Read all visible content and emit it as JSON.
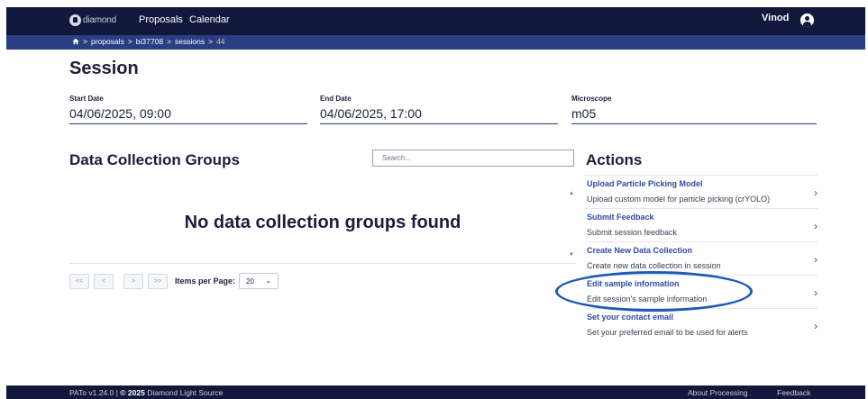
{
  "nav": {
    "logo_text": "diamond",
    "links": [
      "Proposals",
      "Calendar"
    ],
    "user": "Vinod"
  },
  "breadcrumb": {
    "home_icon": "home-icon",
    "separator": ">",
    "items": [
      "proposals",
      "bi37708",
      "sessions"
    ],
    "current": "44"
  },
  "session": {
    "title": "Session",
    "fields": [
      {
        "label": "Start Date",
        "value": "04/06/2025, 09:00"
      },
      {
        "label": "End Date",
        "value": "04/06/2025, 17:00"
      },
      {
        "label": "Microscope",
        "value": "m05"
      }
    ]
  },
  "dcg": {
    "title": "Data Collection Groups",
    "search_placeholder": "Search...",
    "empty_message": "No data collection groups found"
  },
  "pagination": {
    "buttons": [
      "<<",
      "<",
      ">",
      ">>"
    ],
    "items_per_page_label": "Items per Page:",
    "items_per_page_value": "20"
  },
  "actions": {
    "title": "Actions",
    "items": [
      {
        "title": "Upload Particle Picking Model",
        "description": "Upload custom model for particle picking (crYOLO)"
      },
      {
        "title": "Submit Feedback",
        "description": "Submit session feedback"
      },
      {
        "title": "Create New Data Collection",
        "description": "Create new data collection in session"
      },
      {
        "title": "Edit sample information",
        "description": "Edit session's sample information"
      },
      {
        "title": "Set your contact email",
        "description": "Set your preferred email to be used for alerts"
      }
    ]
  },
  "footer": {
    "version": "PATo v1.24.0",
    "separator": "|",
    "copyright": "© 2025",
    "org": "Diamond Light Source",
    "links": [
      "About Processing",
      "Feedback"
    ]
  },
  "colors": {
    "navbar": "#10193c",
    "breadcrumb_bar": "#2a3e84",
    "link": "#2f4aa6",
    "highlight_ring": "#1f5bb4",
    "current_crumb": "#f2c744"
  }
}
